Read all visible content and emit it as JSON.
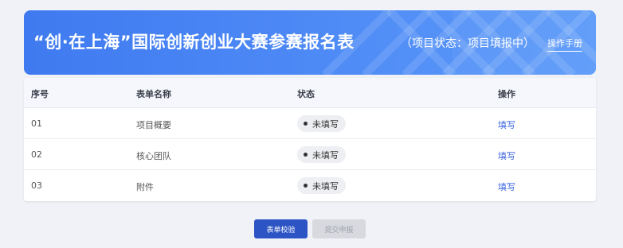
{
  "banner": {
    "title": "“创·在上海”国际创新创业大赛参赛报名表",
    "status": "（项目状态：项目填报中）",
    "manual_link": "操作手册"
  },
  "table": {
    "headers": [
      "序号",
      "表单名称",
      "状态",
      "操作"
    ],
    "rows": [
      {
        "index": "01",
        "name": "项目概要",
        "status": "未填写",
        "action": "填写"
      },
      {
        "index": "02",
        "name": "核心团队",
        "status": "未填写",
        "action": "填写"
      },
      {
        "index": "03",
        "name": "附件",
        "status": "未填写",
        "action": "填写"
      }
    ]
  },
  "buttons": {
    "validate": "表单校验",
    "submit": "提交申报"
  },
  "colors": {
    "banner_primary": "#3f7af0",
    "primary_button": "#2c54c4",
    "link": "#3a64e0",
    "disabled_button": "#d7d9de"
  }
}
